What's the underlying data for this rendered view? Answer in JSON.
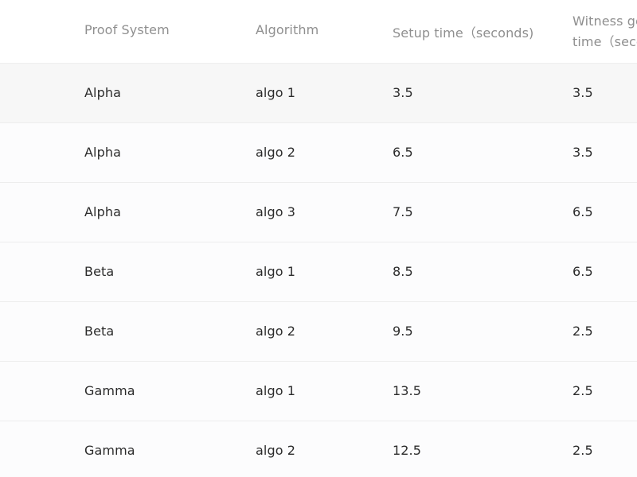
{
  "table": {
    "headers": [
      "Proof System",
      "Algorithm",
      "Setup time（seconds)",
      "Witness generation\ntime（seconds)"
    ],
    "rows": [
      {
        "proof_system": "Alpha",
        "algorithm": "algo 1",
        "setup_time": "3.5",
        "witness_time": "3.5"
      },
      {
        "proof_system": "Alpha",
        "algorithm": "algo 2",
        "setup_time": "6.5",
        "witness_time": "3.5"
      },
      {
        "proof_system": "Alpha",
        "algorithm": "algo 3",
        "setup_time": "7.5",
        "witness_time": "6.5"
      },
      {
        "proof_system": "Beta",
        "algorithm": "algo 1",
        "setup_time": "8.5",
        "witness_time": "6.5"
      },
      {
        "proof_system": "Beta",
        "algorithm": "algo 2",
        "setup_time": "9.5",
        "witness_time": "2.5"
      },
      {
        "proof_system": "Gamma",
        "algorithm": "algo 1",
        "setup_time": "13.5",
        "witness_time": "2.5"
      },
      {
        "proof_system": "Gamma",
        "algorithm": "algo 2",
        "setup_time": "12.5",
        "witness_time": "2.5"
      }
    ]
  }
}
